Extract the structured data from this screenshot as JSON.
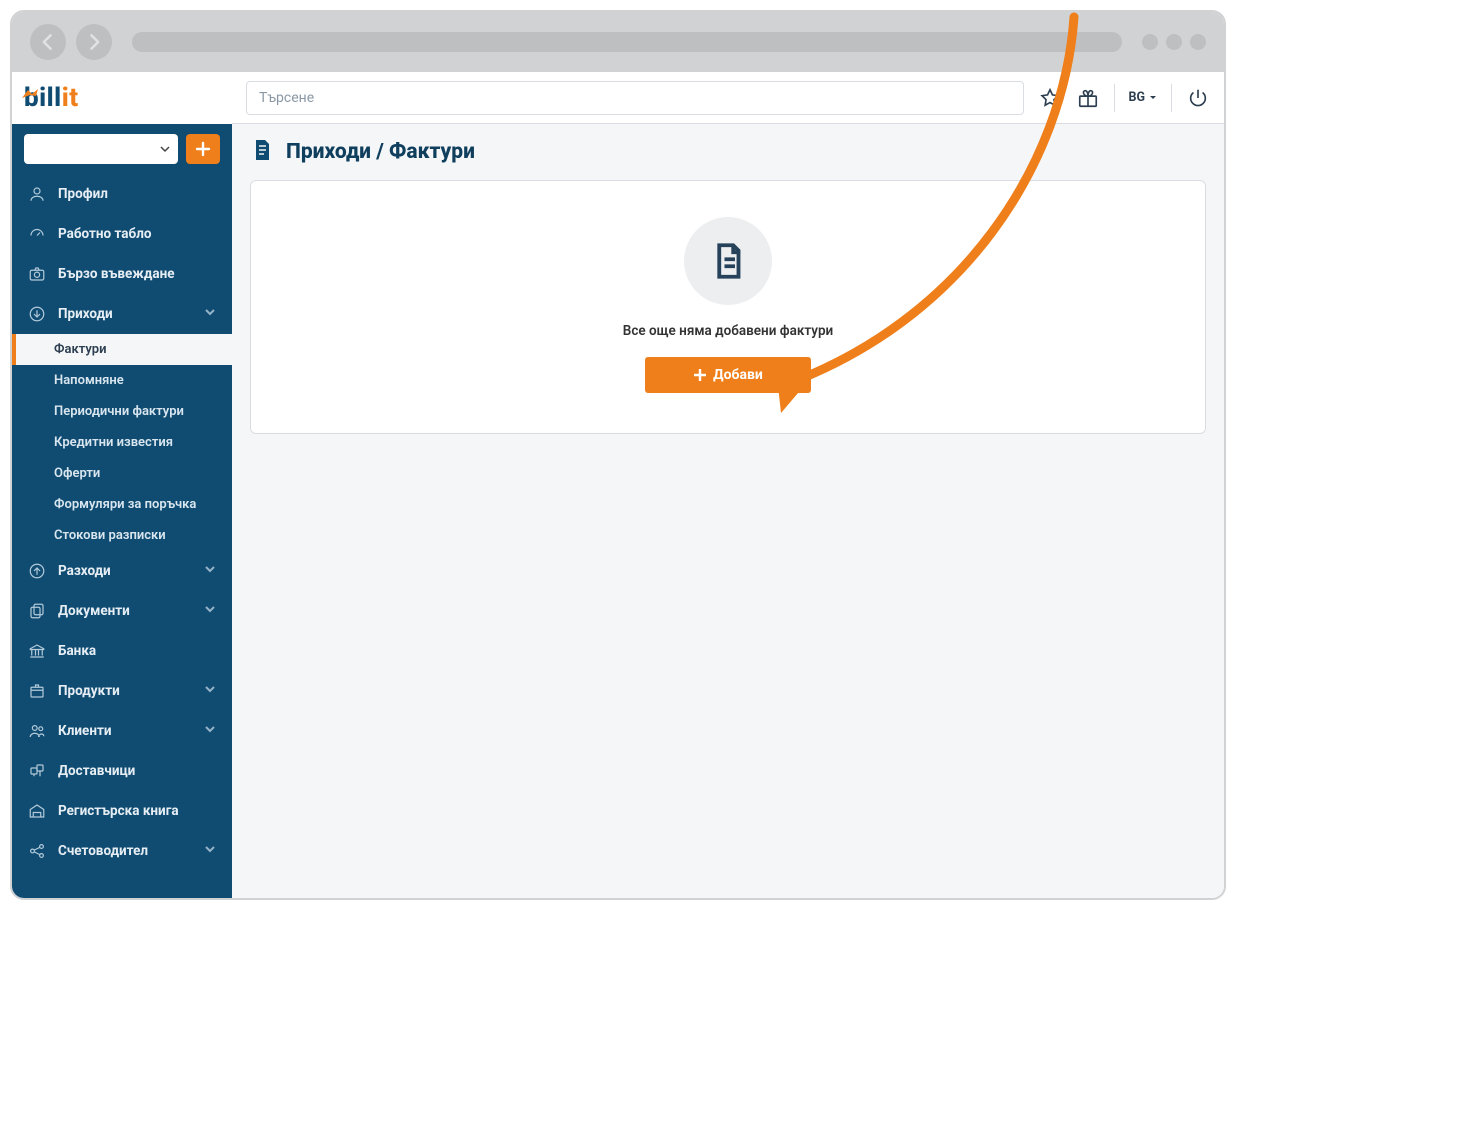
{
  "logo": {
    "text_b": "b",
    "text_ill": "ill",
    "text_it": "it"
  },
  "topbar": {
    "search_placeholder": "Търсене",
    "lang": "BG"
  },
  "page": {
    "title": "Приходи / Фактури",
    "empty_message": "Все още няма добавени фактури",
    "cta_label": "Добави"
  },
  "sidebar": {
    "items": [
      {
        "label": "Профил",
        "icon": "user"
      },
      {
        "label": "Работно табло",
        "icon": "dashboard"
      },
      {
        "label": "Бързо въвеждане",
        "icon": "camera"
      },
      {
        "label": "Приходи",
        "icon": "arrow-down-circle",
        "expandable": true,
        "open": true
      },
      {
        "label": "Разходи",
        "icon": "arrow-up-circle",
        "expandable": true
      },
      {
        "label": "Документи",
        "icon": "copy",
        "expandable": true
      },
      {
        "label": "Банка",
        "icon": "bank"
      },
      {
        "label": "Продукти",
        "icon": "package",
        "expandable": true
      },
      {
        "label": "Клиенти",
        "icon": "users",
        "expandable": true
      },
      {
        "label": "Доставчици",
        "icon": "supplier"
      },
      {
        "label": "Регистърска книга",
        "icon": "warehouse"
      },
      {
        "label": "Счетоводител",
        "icon": "share",
        "expandable": true
      }
    ],
    "income_sub": [
      "Фактури",
      "Напомняне",
      "Периодични фактури",
      "Кредитни известия",
      "Оферти",
      "Формуляри за поръчка",
      "Стокови разписки"
    ]
  }
}
